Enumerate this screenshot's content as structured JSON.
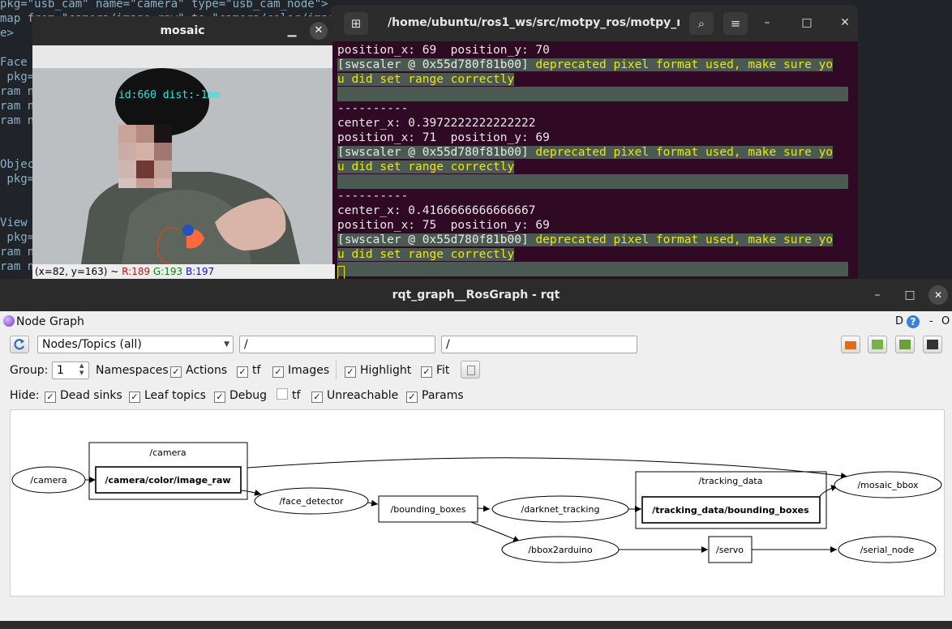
{
  "editor": {
    "lines": [
      "pkg=\"usb_cam\" name=\"camera\" type=\"usb_cam_node\">",
      "map from=\"camera/image_raw\" to=\"camera/color/image",
      "e>",
      "",
      "Face d",
      " pkg=",
      "ram na",
      "ram na",
      "ram na",
      "",
      "",
      "Object",
      " pkg=",
      "",
      "",
      "View d",
      " pkg=",
      "ram na",
      "ram na"
    ]
  },
  "terminal": {
    "title": "/home/ubuntu/ros1_ws/src/motpy_ros/motpy_r...",
    "icons": {
      "new_tab": "new-tab-icon",
      "search": "search-icon",
      "menu": "hamburger-menu-icon"
    },
    "lines": [
      "position_x: 69  position_y: 70",
      "[swscaler @ 0x55d780f81b00]",
      " deprecated pixel format used, make sure yo",
      "u did set range correctly",
      "----------",
      "center_x: 0.3972222222222222",
      "position_x: 71  position_y: 69",
      "[swscaler @ 0x55d780f81b00]",
      " deprecated pixel format used, make sure yo",
      "u did set range correctly",
      "----------",
      "center_x: 0.4166666666666667",
      "position_x: 75  position_y: 69",
      "[swscaler @ 0x55d780f81b00]",
      " deprecated pixel format used, make sure yo",
      "u did set range correctly"
    ]
  },
  "mosaic": {
    "title": "mosaic",
    "overlay_label": "id:660 dist:-1mm",
    "status_prefix": "(x=82, y=163) ~ ",
    "r": "R:189",
    "g": "G:193",
    "b": "B:197"
  },
  "rqt": {
    "title": "rqt_graph__RosGraph - rqt",
    "plugin_title": "Node Graph",
    "plugin_controls": {
      "d": "D",
      "help": "?",
      "dash": "-",
      "o": "O"
    },
    "filter_combo": "Nodes/Topics (all)",
    "ns_filter": "/",
    "topic_filter": "/",
    "group_label": "Group:",
    "group_value": "1",
    "options": [
      "Namespaces",
      "Actions",
      "tf",
      "Images",
      "Highlight",
      "Fit"
    ],
    "options_checked": [
      false,
      true,
      true,
      true,
      true,
      true
    ],
    "hide_label": "Hide:",
    "hide": [
      "Dead sinks",
      "Leaf topics",
      "Debug",
      "tf",
      "Unreachable",
      "Params"
    ],
    "hide_checked": [
      true,
      true,
      true,
      false,
      true,
      true
    ]
  },
  "graph": {
    "nodes": {
      "camera": "/camera",
      "face_detector": "/face_detector",
      "darknet_tracking": "/darknet_tracking",
      "mosaic_bbox": "/mosaic_bbox",
      "bbox2arduino": "/bbox2arduino",
      "serial_node": "/serial_node"
    },
    "topics": {
      "image_raw": "/camera/color/image_raw",
      "bounding_boxes": "/bounding_boxes",
      "tracking_bboxes": "/tracking_data/bounding_boxes",
      "servo": "/servo"
    },
    "clusters": {
      "camera": "/camera",
      "tracking_data": "/tracking_data"
    }
  }
}
